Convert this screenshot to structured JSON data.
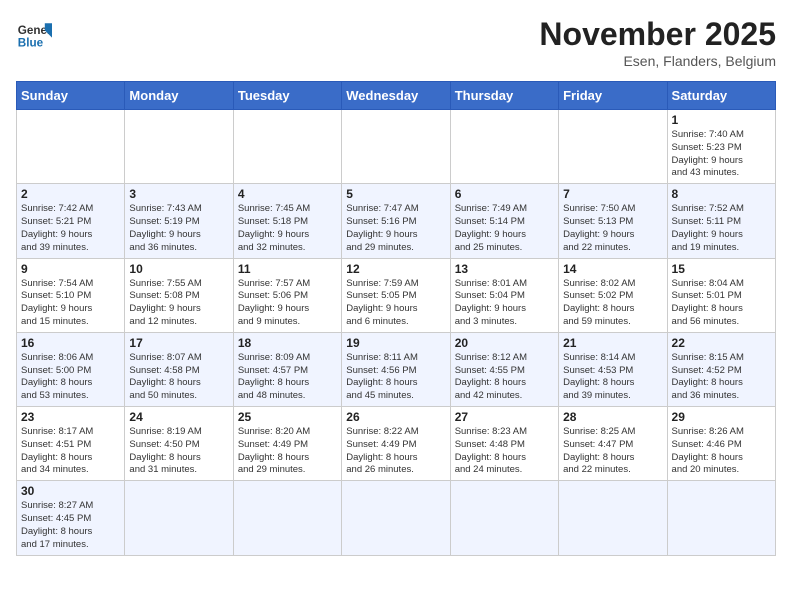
{
  "header": {
    "logo_general": "General",
    "logo_blue": "Blue",
    "month": "November 2025",
    "location": "Esen, Flanders, Belgium"
  },
  "weekdays": [
    "Sunday",
    "Monday",
    "Tuesday",
    "Wednesday",
    "Thursday",
    "Friday",
    "Saturday"
  ],
  "weeks": [
    [
      {
        "day": "",
        "info": ""
      },
      {
        "day": "",
        "info": ""
      },
      {
        "day": "",
        "info": ""
      },
      {
        "day": "",
        "info": ""
      },
      {
        "day": "",
        "info": ""
      },
      {
        "day": "",
        "info": ""
      },
      {
        "day": "1",
        "info": "Sunrise: 7:40 AM\nSunset: 5:23 PM\nDaylight: 9 hours\nand 43 minutes."
      }
    ],
    [
      {
        "day": "2",
        "info": "Sunrise: 7:42 AM\nSunset: 5:21 PM\nDaylight: 9 hours\nand 39 minutes."
      },
      {
        "day": "3",
        "info": "Sunrise: 7:43 AM\nSunset: 5:19 PM\nDaylight: 9 hours\nand 36 minutes."
      },
      {
        "day": "4",
        "info": "Sunrise: 7:45 AM\nSunset: 5:18 PM\nDaylight: 9 hours\nand 32 minutes."
      },
      {
        "day": "5",
        "info": "Sunrise: 7:47 AM\nSunset: 5:16 PM\nDaylight: 9 hours\nand 29 minutes."
      },
      {
        "day": "6",
        "info": "Sunrise: 7:49 AM\nSunset: 5:14 PM\nDaylight: 9 hours\nand 25 minutes."
      },
      {
        "day": "7",
        "info": "Sunrise: 7:50 AM\nSunset: 5:13 PM\nDaylight: 9 hours\nand 22 minutes."
      },
      {
        "day": "8",
        "info": "Sunrise: 7:52 AM\nSunset: 5:11 PM\nDaylight: 9 hours\nand 19 minutes."
      }
    ],
    [
      {
        "day": "9",
        "info": "Sunrise: 7:54 AM\nSunset: 5:10 PM\nDaylight: 9 hours\nand 15 minutes."
      },
      {
        "day": "10",
        "info": "Sunrise: 7:55 AM\nSunset: 5:08 PM\nDaylight: 9 hours\nand 12 minutes."
      },
      {
        "day": "11",
        "info": "Sunrise: 7:57 AM\nSunset: 5:06 PM\nDaylight: 9 hours\nand 9 minutes."
      },
      {
        "day": "12",
        "info": "Sunrise: 7:59 AM\nSunset: 5:05 PM\nDaylight: 9 hours\nand 6 minutes."
      },
      {
        "day": "13",
        "info": "Sunrise: 8:01 AM\nSunset: 5:04 PM\nDaylight: 9 hours\nand 3 minutes."
      },
      {
        "day": "14",
        "info": "Sunrise: 8:02 AM\nSunset: 5:02 PM\nDaylight: 8 hours\nand 59 minutes."
      },
      {
        "day": "15",
        "info": "Sunrise: 8:04 AM\nSunset: 5:01 PM\nDaylight: 8 hours\nand 56 minutes."
      }
    ],
    [
      {
        "day": "16",
        "info": "Sunrise: 8:06 AM\nSunset: 5:00 PM\nDaylight: 8 hours\nand 53 minutes."
      },
      {
        "day": "17",
        "info": "Sunrise: 8:07 AM\nSunset: 4:58 PM\nDaylight: 8 hours\nand 50 minutes."
      },
      {
        "day": "18",
        "info": "Sunrise: 8:09 AM\nSunset: 4:57 PM\nDaylight: 8 hours\nand 48 minutes."
      },
      {
        "day": "19",
        "info": "Sunrise: 8:11 AM\nSunset: 4:56 PM\nDaylight: 8 hours\nand 45 minutes."
      },
      {
        "day": "20",
        "info": "Sunrise: 8:12 AM\nSunset: 4:55 PM\nDaylight: 8 hours\nand 42 minutes."
      },
      {
        "day": "21",
        "info": "Sunrise: 8:14 AM\nSunset: 4:53 PM\nDaylight: 8 hours\nand 39 minutes."
      },
      {
        "day": "22",
        "info": "Sunrise: 8:15 AM\nSunset: 4:52 PM\nDaylight: 8 hours\nand 36 minutes."
      }
    ],
    [
      {
        "day": "23",
        "info": "Sunrise: 8:17 AM\nSunset: 4:51 PM\nDaylight: 8 hours\nand 34 minutes."
      },
      {
        "day": "24",
        "info": "Sunrise: 8:19 AM\nSunset: 4:50 PM\nDaylight: 8 hours\nand 31 minutes."
      },
      {
        "day": "25",
        "info": "Sunrise: 8:20 AM\nSunset: 4:49 PM\nDaylight: 8 hours\nand 29 minutes."
      },
      {
        "day": "26",
        "info": "Sunrise: 8:22 AM\nSunset: 4:49 PM\nDaylight: 8 hours\nand 26 minutes."
      },
      {
        "day": "27",
        "info": "Sunrise: 8:23 AM\nSunset: 4:48 PM\nDaylight: 8 hours\nand 24 minutes."
      },
      {
        "day": "28",
        "info": "Sunrise: 8:25 AM\nSunset: 4:47 PM\nDaylight: 8 hours\nand 22 minutes."
      },
      {
        "day": "29",
        "info": "Sunrise: 8:26 AM\nSunset: 4:46 PM\nDaylight: 8 hours\nand 20 minutes."
      }
    ],
    [
      {
        "day": "30",
        "info": "Sunrise: 8:27 AM\nSunset: 4:45 PM\nDaylight: 8 hours\nand 17 minutes."
      },
      {
        "day": "",
        "info": ""
      },
      {
        "day": "",
        "info": ""
      },
      {
        "day": "",
        "info": ""
      },
      {
        "day": "",
        "info": ""
      },
      {
        "day": "",
        "info": ""
      },
      {
        "day": "",
        "info": ""
      }
    ]
  ]
}
